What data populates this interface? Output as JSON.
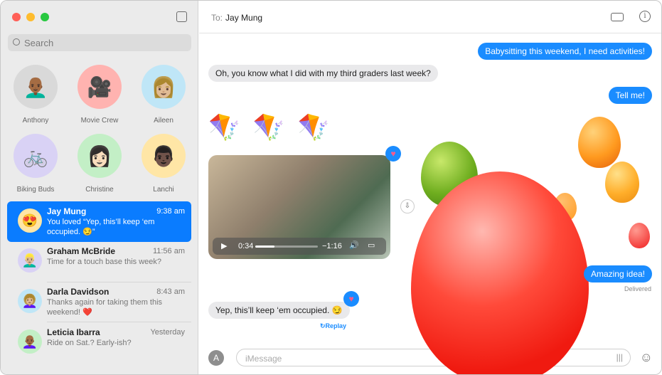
{
  "sidebar": {
    "search_placeholder": "Search",
    "pinned": [
      {
        "name": "Anthony",
        "bg": "#d9d9d9",
        "emoji": "👨🏾‍🦲"
      },
      {
        "name": "Movie Crew",
        "bg": "#ffb3b0",
        "emoji": "🎥"
      },
      {
        "name": "Aileen",
        "bg": "#bfe6f7",
        "emoji": "👩🏼"
      },
      {
        "name": "Biking Buds",
        "bg": "#d9d2f5",
        "emoji": "🚲"
      },
      {
        "name": "Christine",
        "bg": "#c3efc6",
        "emoji": "👩🏻"
      },
      {
        "name": "Lanchi",
        "bg": "#ffe6a6",
        "emoji": "👨🏿"
      }
    ],
    "conversations": [
      {
        "name": "Jay Mung",
        "time": "9:38 am",
        "preview": "You loved “Yep, this’ll keep ‘em occupied. 😏”",
        "bg": "#ffe6a6",
        "emoji": "😍"
      },
      {
        "name": "Graham McBride",
        "time": "11:56 am",
        "preview": "Time for a touch base this week?",
        "bg": "#d9d2f5",
        "emoji": "👱🏼‍♂️"
      },
      {
        "name": "Darla Davidson",
        "time": "8:43 am",
        "preview": "Thanks again for taking them this weekend! ❤️",
        "bg": "#bfe6f7",
        "emoji": "👩🏼‍🦱"
      },
      {
        "name": "Leticia Ibarra",
        "time": "Yesterday",
        "preview": "Ride on Sat.? Early-ish?",
        "bg": "#c3efc6",
        "emoji": "👩🏾‍🦲"
      }
    ]
  },
  "header": {
    "to_label": "To:",
    "recipient": "Jay Mung"
  },
  "messages": [
    {
      "text": "Babysitting this weekend, I need activities!"
    },
    {
      "text": "Oh, you know what I did with my third graders last week?"
    },
    {
      "text": "Tell me!"
    },
    {
      "text": "🪁 🪁 🪁"
    },
    {
      "text": "Amazing idea!"
    },
    {
      "text": "Yep, this’ll keep ‘em occupied. 😏"
    }
  ],
  "video": {
    "elapsed": "0:34",
    "remaining": "−1:16",
    "progress": 0.31
  },
  "status": {
    "delivered": "Delivered",
    "replay": "↻Replay"
  },
  "composer": {
    "placeholder": "iMessage"
  },
  "colors": {
    "accent": "#0a7cff",
    "bubble_out": "#1a8cff",
    "bubble_in": "#e9e9eb"
  }
}
